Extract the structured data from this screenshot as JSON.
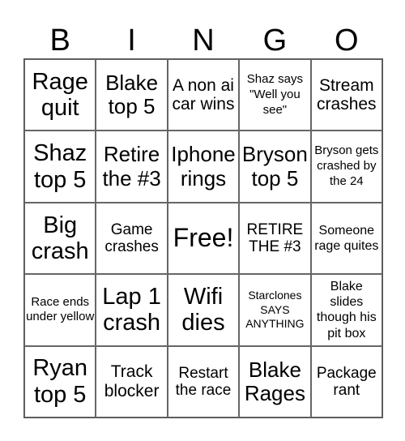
{
  "header": {
    "letters": [
      "B",
      "I",
      "N",
      "G",
      "O"
    ]
  },
  "cells": [
    [
      "Rage quit",
      "Blake top 5",
      "A non ai car wins",
      "Shaz says \"Well you see\"",
      "Stream crashes"
    ],
    [
      "Shaz top 5",
      "Retire the #3",
      "Iphone rings",
      "Bryson top 5",
      "Bryson gets crashed by the 24"
    ],
    [
      "Big crash",
      "Game crashes",
      "Free!",
      "RETIRE THE #3",
      "Someone rage quites"
    ],
    [
      "Race ends under yellow",
      "Lap 1 crash",
      "Wifi dies",
      "Starclones SAYS ANYTHING",
      "Blake slides though his pit box"
    ],
    [
      "Ryan top 5",
      "Track blocker",
      "Restart the race",
      "Blake Rages",
      "Package rant"
    ]
  ]
}
